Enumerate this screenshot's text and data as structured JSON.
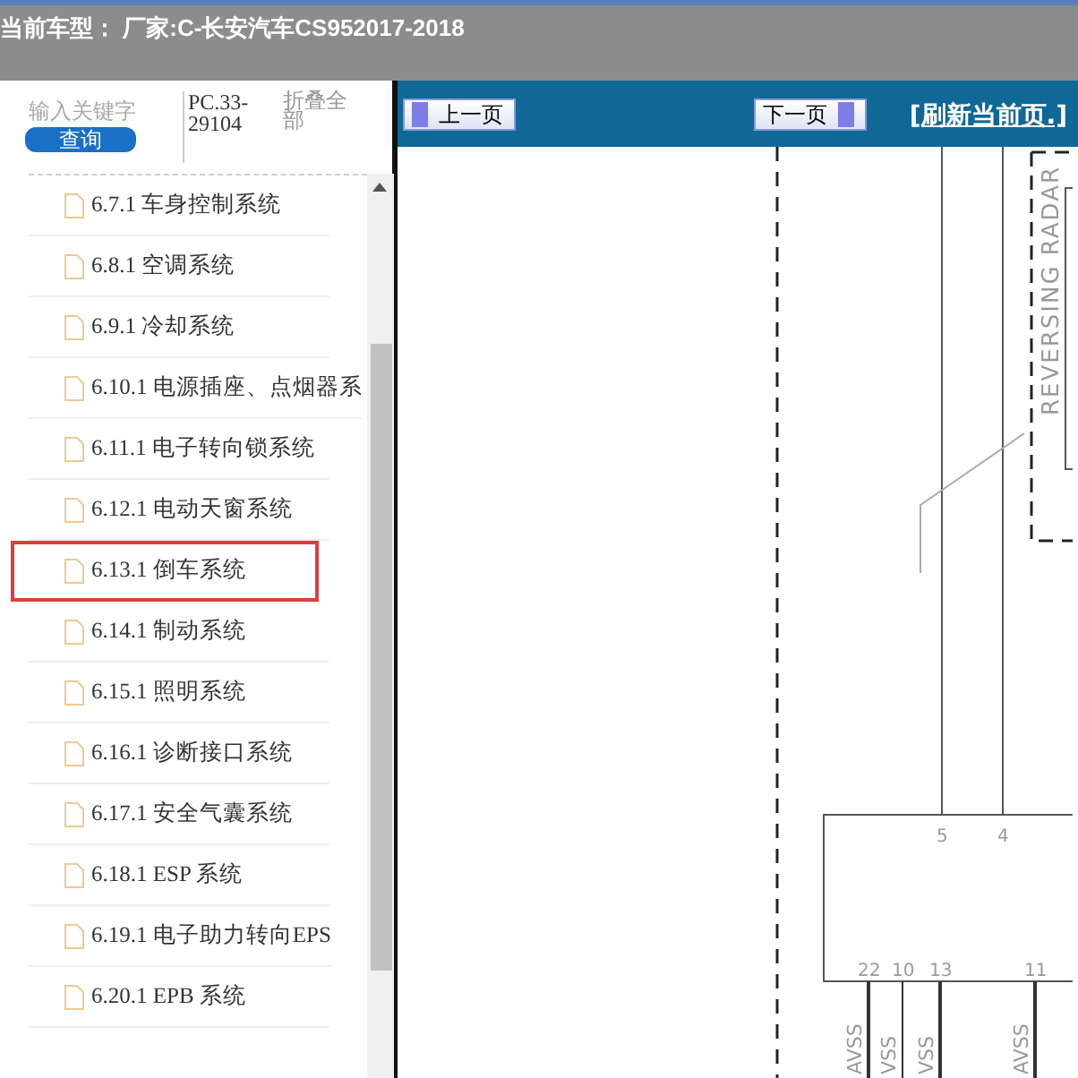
{
  "header": {
    "title": "当前车型： 厂家:C-长安汽车CS952017-2018"
  },
  "search": {
    "placeholder": "输入关键字",
    "button": "查询",
    "code": "PC.33-29104",
    "collapse": "折叠全部"
  },
  "tree": [
    {
      "label": "6.7.1 车身控制系统",
      "highlighted": false
    },
    {
      "label": "6.8.1 空调系统",
      "highlighted": false
    },
    {
      "label": "6.9.1 冷却系统",
      "highlighted": false
    },
    {
      "label": "6.10.1 电源插座、点烟器系",
      "highlighted": false
    },
    {
      "label": "6.11.1 电子转向锁系统",
      "highlighted": false
    },
    {
      "label": "6.12.1 电动天窗系统",
      "highlighted": false
    },
    {
      "label": "6.13.1 倒车系统",
      "highlighted": true
    },
    {
      "label": "6.14.1 制动系统",
      "highlighted": false
    },
    {
      "label": "6.15.1 照明系统",
      "highlighted": false
    },
    {
      "label": "6.16.1 诊断接口系统",
      "highlighted": false
    },
    {
      "label": "6.17.1 安全气囊系统",
      "highlighted": false
    },
    {
      "label": "6.18.1 ESP 系统",
      "highlighted": false
    },
    {
      "label": "6.19.1 电子助力转向EPS",
      "highlighted": false
    },
    {
      "label": "6.20.1 EPB 系统",
      "highlighted": false
    }
  ],
  "toolbar": {
    "prev": "上一页",
    "next": "下一页",
    "refresh": "[刷新当前页.]"
  },
  "diagram": {
    "module": "REVERSING RADAR",
    "top_pins": [
      "5",
      "4"
    ],
    "bottom_pins": [
      {
        "number": "22",
        "signal": "AVSS"
      },
      {
        "number": "10",
        "signal": "VSS"
      },
      {
        "number": "13",
        "signal": "VSS"
      },
      {
        "number": "11",
        "signal": "AVSS"
      }
    ]
  }
}
